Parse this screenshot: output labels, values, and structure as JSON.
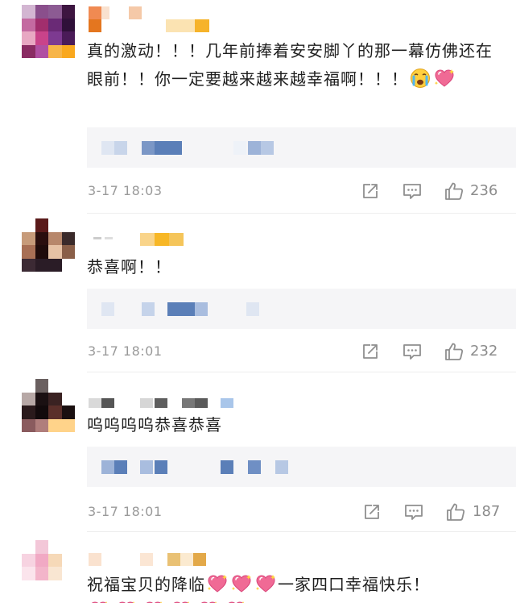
{
  "comments": [
    {
      "text": "真的激动！！！几年前捧着安安脚丫的那一幕仿佛还在眼前！！你一定要越来越来越幸福啊！！！",
      "emojis": [
        "crying-face-emoji",
        "sparkling-heart-emoji"
      ],
      "date": "3-17 18:03",
      "likes": "236"
    },
    {
      "text": "恭喜啊！！",
      "date": "3-17 18:01",
      "likes": "232"
    },
    {
      "text": "呜呜呜呜恭喜恭喜",
      "date": "3-17 18:01",
      "likes": "187"
    },
    {
      "text_before": "祝福宝贝的降临",
      "emojis": [
        "sparkling-heart-emoji",
        "sparkling-heart-emoji",
        "sparkling-heart-emoji"
      ],
      "text_after": "一家四口幸福快乐！"
    }
  ],
  "colors": {
    "reply_box_bg": "#f5f5f7",
    "meta_gray": "#9a9a9a",
    "heart_pink": "#f06a95",
    "heart_dark": "#e0467a"
  }
}
